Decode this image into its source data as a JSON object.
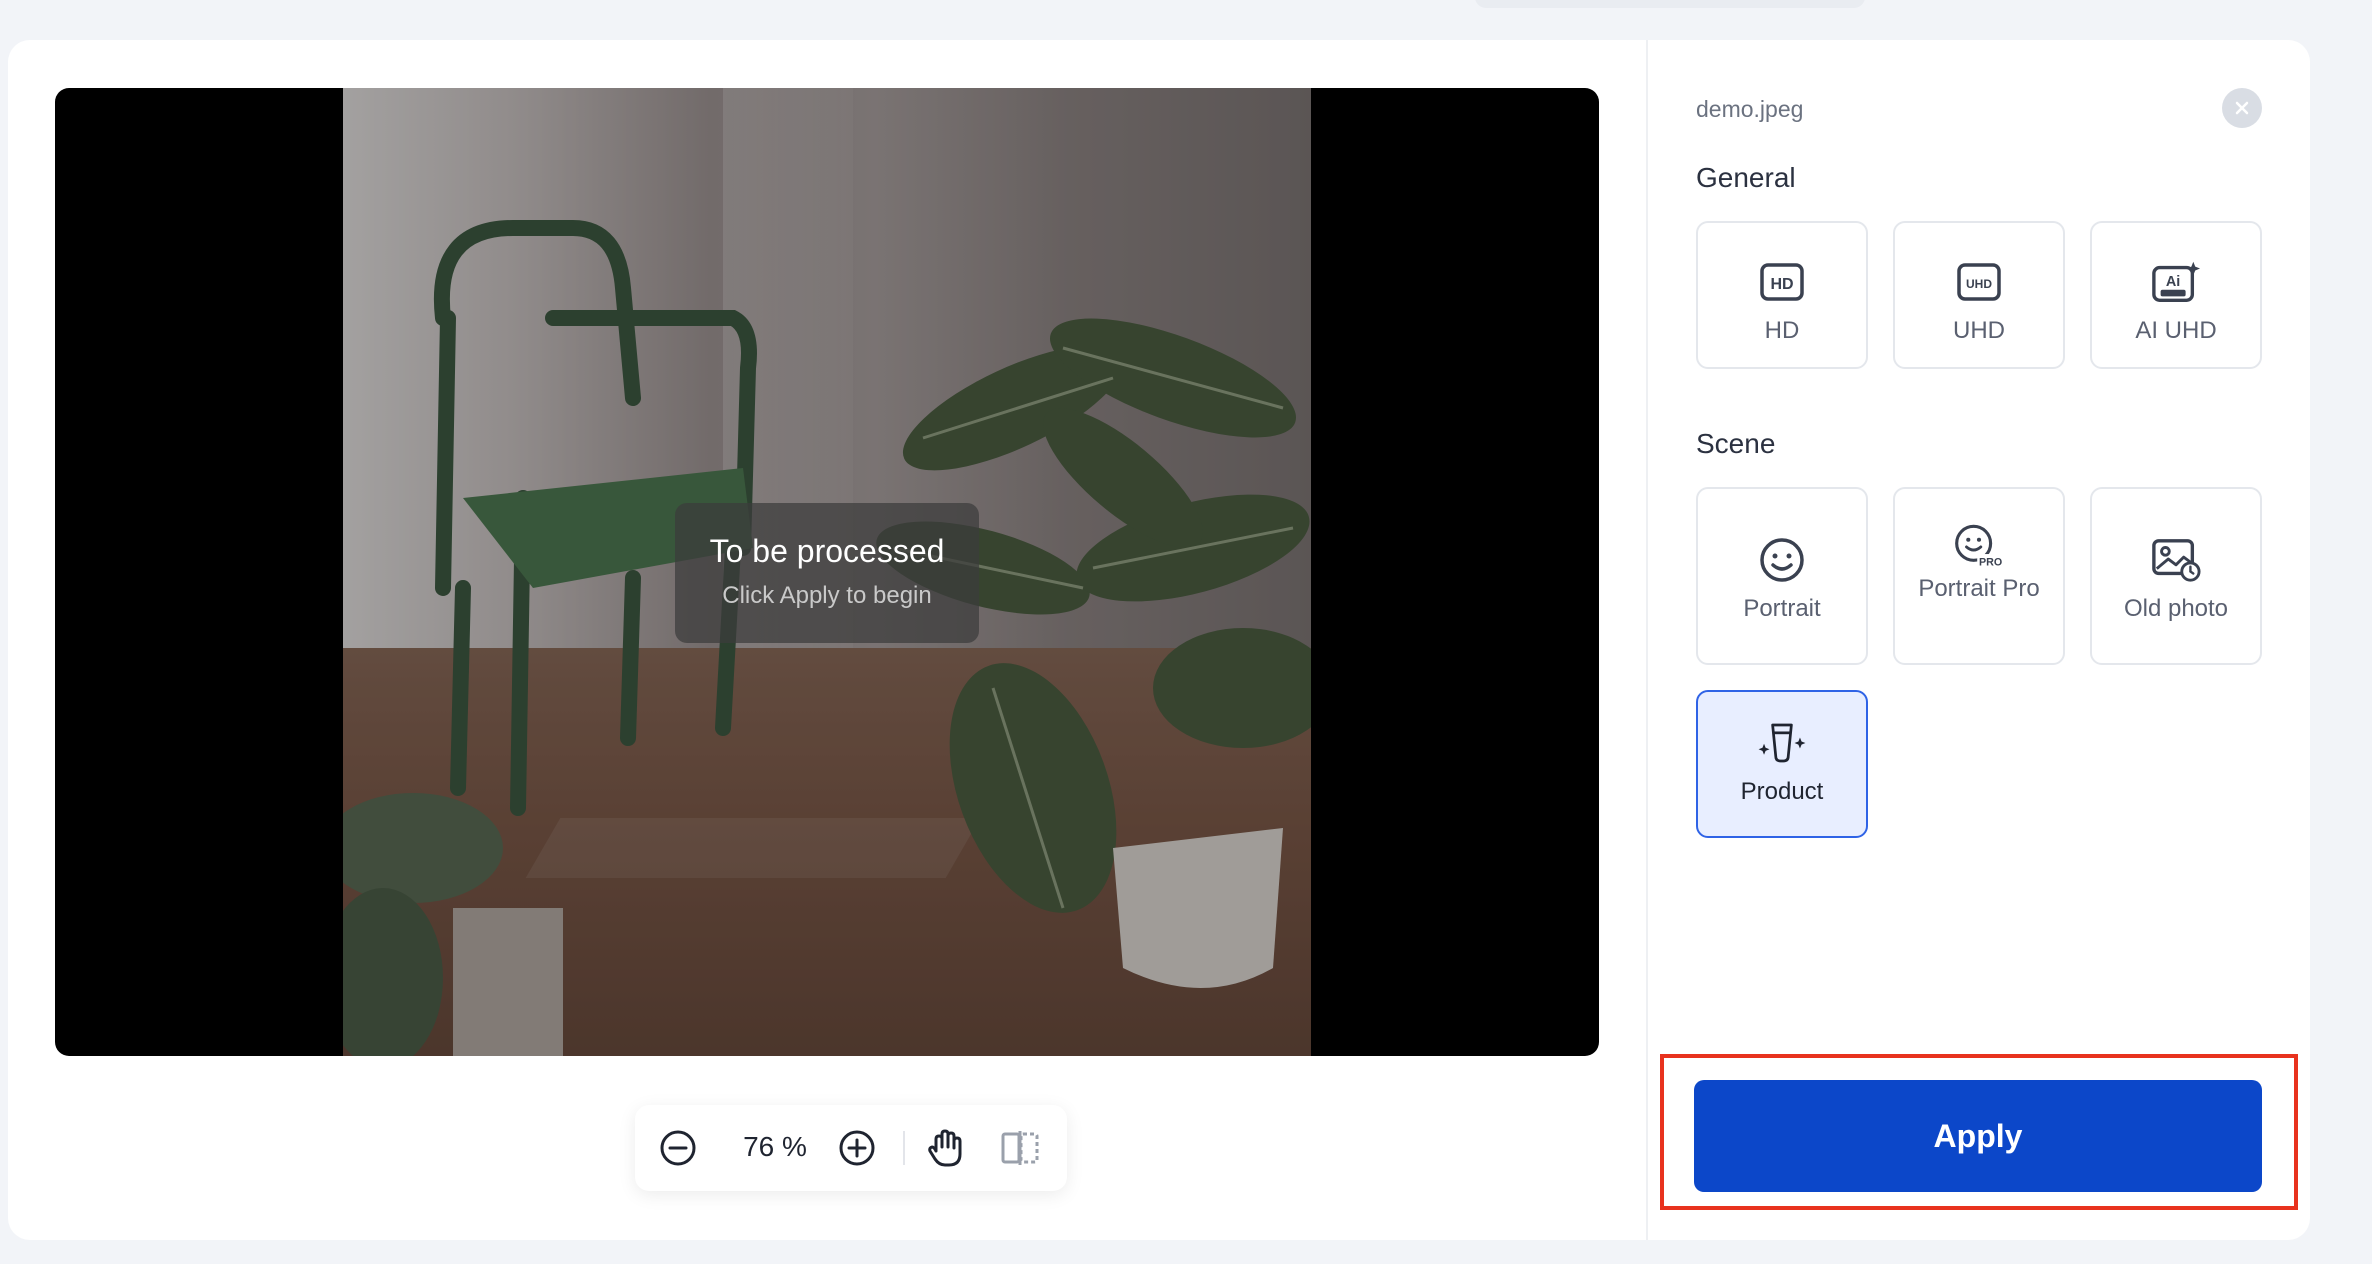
{
  "file": {
    "name": "demo.jpeg"
  },
  "preview": {
    "status_title": "To be processed",
    "status_subtitle": "Click Apply to begin"
  },
  "toolbar": {
    "zoom_level": "76 %"
  },
  "sections": {
    "general_title": "General",
    "scene_title": "Scene"
  },
  "general_options": [
    {
      "label": "HD",
      "icon": "hd-icon"
    },
    {
      "label": "UHD",
      "icon": "uhd-icon"
    },
    {
      "label": "AI UHD",
      "icon": "ai-uhd-icon"
    }
  ],
  "scene_options": [
    {
      "label": "Portrait",
      "icon": "smiley-icon"
    },
    {
      "label": "Portrait Pro",
      "icon": "smiley-pro-icon"
    },
    {
      "label": "Old photo",
      "icon": "old-photo-icon"
    },
    {
      "label": "Product",
      "icon": "product-icon",
      "selected": true
    }
  ],
  "apply_label": "Apply",
  "colors": {
    "accent": "#0c47c9",
    "selected_bg": "#e8eeff",
    "selected_border": "#2f63e6",
    "highlight_frame": "#e8321e"
  }
}
